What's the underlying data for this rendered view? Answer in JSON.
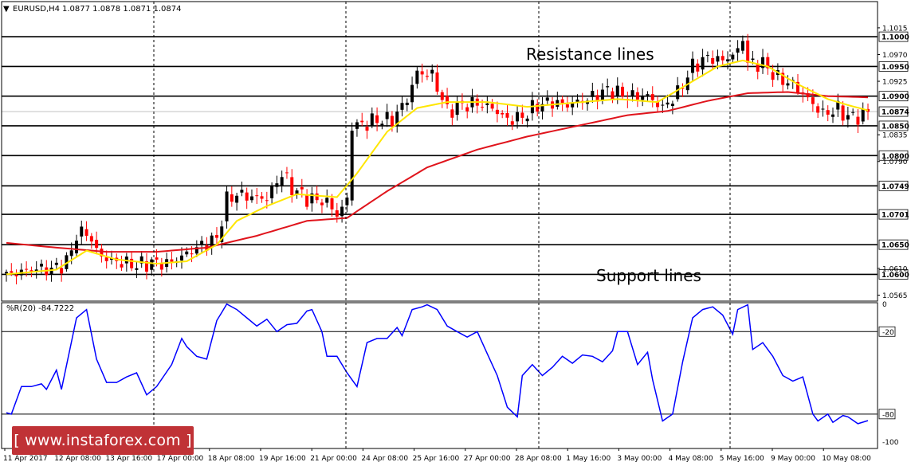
{
  "header": {
    "symbol_label": "EURUSD,H4",
    "ohlc_label": "1.0877 1.0878 1.0871 1.0874"
  },
  "annotations": {
    "resistance": "Resistance lines",
    "support": "Support lines"
  },
  "indicator": {
    "label": "%R(20) -84.7222",
    "levels": [
      "0",
      "-20",
      "-80",
      "-100"
    ]
  },
  "watermark": "[ www.instaforex.com ]",
  "colors": {
    "bull_body": "#000000",
    "bear_body": "#ff0000",
    "sma_fast": "#ffe600",
    "sma_slow": "#e0141c",
    "wpr_line": "#0000ff",
    "level_line": "#000000",
    "current_price_line": "#c0c0c0"
  },
  "chart_data": [
    {
      "type": "candlestick",
      "title": "EURUSD,H4",
      "ylim": [
        1.0555,
        1.1035
      ],
      "y_ticks": [
        "1.1015",
        "1.0970",
        "1.0925",
        "1.0835",
        "1.0790",
        "1.0610",
        "1.0565"
      ],
      "x_ticks": [
        "11 Apr 2017",
        "12 Apr 08:00",
        "13 Apr 16:00",
        "17 Apr 00:00",
        "18 Apr 08:00",
        "19 Apr 16:00",
        "21 Apr 00:00",
        "24 Apr 08:00",
        "25 Apr 16:00",
        "27 Apr 00:00",
        "28 Apr 08:00",
        "1 May 16:00",
        "3 May 00:00",
        "4 May 08:00",
        "5 May 16:00",
        "9 May 00:00",
        "10 May 08:00"
      ],
      "horizontal_levels": [
        {
          "label": "1.1000",
          "value": 1.1
        },
        {
          "label": "1.0950",
          "value": 1.095
        },
        {
          "label": "1.0900",
          "value": 1.09
        },
        {
          "label": "1.0850",
          "value": 1.085
        },
        {
          "label": "1.0800",
          "value": 1.08
        },
        {
          "label": "1.0749",
          "value": 1.0749
        },
        {
          "label": "1.0701",
          "value": 1.0701
        },
        {
          "label": "1.0650",
          "value": 1.065
        },
        {
          "label": "1.0600",
          "value": 1.06
        }
      ],
      "current_price": {
        "label": "1.0874",
        "value": 1.0874
      },
      "period_separators": [
        "12 Apr",
        "17 Apr",
        "24 Apr",
        "27 Apr",
        "3 May",
        "5 May"
      ],
      "anchors": [
        [
          0,
          1.0598
        ],
        [
          3,
          1.0605
        ],
        [
          6,
          1.061
        ],
        [
          9,
          1.0608
        ],
        [
          12,
          1.062
        ],
        [
          14,
          1.0665
        ],
        [
          16,
          1.0672
        ],
        [
          18,
          1.064
        ],
        [
          20,
          1.0625
        ],
        [
          23,
          1.062
        ],
        [
          26,
          1.0615
        ],
        [
          29,
          1.062
        ],
        [
          32,
          1.0618
        ],
        [
          35,
          1.063
        ],
        [
          38,
          1.0645
        ],
        [
          42,
          1.066
        ],
        [
          44,
          1.0725
        ],
        [
          46,
          1.0735
        ],
        [
          49,
          1.073
        ],
        [
          52,
          1.0728
        ],
        [
          55,
          1.077
        ],
        [
          57,
          1.0745
        ],
        [
          60,
          1.0728
        ],
        [
          64,
          1.0722
        ],
        [
          66,
          1.07
        ],
        [
          68,
          1.0725
        ],
        [
          69,
          1.085
        ],
        [
          71,
          1.0852
        ],
        [
          74,
          1.086
        ],
        [
          77,
          1.086
        ],
        [
          80,
          1.0895
        ],
        [
          82,
          1.094
        ],
        [
          85,
          1.0935
        ],
        [
          88,
          1.0875
        ],
        [
          91,
          1.0885
        ],
        [
          94,
          1.0888
        ],
        [
          97,
          1.088
        ],
        [
          100,
          1.086
        ],
        [
          103,
          1.0865
        ],
        [
          106,
          1.0885
        ],
        [
          109,
          1.089
        ],
        [
          112,
          1.0885
        ],
        [
          116,
          1.0895
        ],
        [
          120,
          1.091
        ],
        [
          124,
          1.09
        ],
        [
          128,
          1.09
        ],
        [
          131,
          1.088
        ],
        [
          134,
          1.0905
        ],
        [
          137,
          1.095
        ],
        [
          140,
          1.0965
        ],
        [
          143,
          1.096
        ],
        [
          146,
          1.0975
        ],
        [
          147,
          1.1
        ],
        [
          148,
          1.0955
        ],
        [
          151,
          1.0955
        ],
        [
          154,
          1.093
        ],
        [
          157,
          1.092
        ],
        [
          160,
          1.0895
        ],
        [
          163,
          1.087
        ],
        [
          166,
          1.0878
        ],
        [
          168,
          1.0865
        ],
        [
          170,
          1.0865
        ],
        [
          172,
          1.0874
        ]
      ],
      "sma_fast_points": [
        [
          0,
          1.06
        ],
        [
          10,
          1.0608
        ],
        [
          16,
          1.064
        ],
        [
          22,
          1.0625
        ],
        [
          30,
          1.0618
        ],
        [
          36,
          1.0622
        ],
        [
          42,
          1.065
        ],
        [
          46,
          1.069
        ],
        [
          52,
          1.0715
        ],
        [
          58,
          1.0735
        ],
        [
          66,
          1.073
        ],
        [
          70,
          1.077
        ],
        [
          76,
          1.084
        ],
        [
          82,
          1.088
        ],
        [
          88,
          1.089
        ],
        [
          96,
          1.089
        ],
        [
          104,
          1.0882
        ],
        [
          112,
          1.0888
        ],
        [
          122,
          1.0895
        ],
        [
          130,
          1.089
        ],
        [
          136,
          1.092
        ],
        [
          142,
          1.095
        ],
        [
          147,
          1.096
        ],
        [
          152,
          1.095
        ],
        [
          158,
          1.092
        ],
        [
          164,
          1.0895
        ],
        [
          168,
          1.0885
        ],
        [
          172,
          1.0876
        ]
      ],
      "sma_slow_points": [
        [
          0,
          1.0653
        ],
        [
          10,
          1.0645
        ],
        [
          20,
          1.0638
        ],
        [
          30,
          1.0638
        ],
        [
          40,
          1.0645
        ],
        [
          50,
          1.0665
        ],
        [
          60,
          1.069
        ],
        [
          68,
          1.0695
        ],
        [
          76,
          1.074
        ],
        [
          84,
          1.078
        ],
        [
          94,
          1.081
        ],
        [
          104,
          1.0832
        ],
        [
          114,
          1.085
        ],
        [
          124,
          1.0868
        ],
        [
          132,
          1.0875
        ],
        [
          140,
          1.0892
        ],
        [
          148,
          1.0905
        ],
        [
          156,
          1.0907
        ],
        [
          164,
          1.09
        ],
        [
          172,
          1.0898
        ]
      ]
    },
    {
      "type": "line",
      "title": "%R(20) -84.7222",
      "ylim": [
        -105,
        1
      ],
      "levels": [
        -20,
        -80
      ],
      "points": [
        [
          0,
          -79
        ],
        [
          1,
          -80
        ],
        [
          3,
          -60
        ],
        [
          5,
          -60
        ],
        [
          7,
          -58
        ],
        [
          8,
          -62
        ],
        [
          10,
          -48
        ],
        [
          11,
          -62
        ],
        [
          14,
          -10
        ],
        [
          16,
          -4
        ],
        [
          18,
          -40
        ],
        [
          20,
          -57
        ],
        [
          22,
          -57
        ],
        [
          24,
          -53
        ],
        [
          26,
          -50
        ],
        [
          28,
          -66
        ],
        [
          30,
          -60
        ],
        [
          33,
          -44
        ],
        [
          35,
          -25
        ],
        [
          36,
          -31
        ],
        [
          38,
          -38
        ],
        [
          40,
          -40
        ],
        [
          42,
          -12
        ],
        [
          43,
          -6
        ],
        [
          44,
          0
        ],
        [
          46,
          -4
        ],
        [
          48,
          -10
        ],
        [
          50,
          -16
        ],
        [
          52,
          -11
        ],
        [
          54,
          -20
        ],
        [
          56,
          -15
        ],
        [
          58,
          -14
        ],
        [
          60,
          -5
        ],
        [
          61,
          -4
        ],
        [
          63,
          -20
        ],
        [
          64,
          -38
        ],
        [
          66,
          -38
        ],
        [
          68,
          -50
        ],
        [
          70,
          -60
        ],
        [
          72,
          -28
        ],
        [
          74,
          -25
        ],
        [
          76,
          -25
        ],
        [
          78,
          -17
        ],
        [
          79,
          -23
        ],
        [
          81,
          -4
        ],
        [
          83,
          -2
        ],
        [
          84,
          -0.5
        ],
        [
          86,
          -4
        ],
        [
          88,
          -16
        ],
        [
          90,
          -20
        ],
        [
          92,
          -24
        ],
        [
          94,
          -20
        ],
        [
          96,
          -36
        ],
        [
          98,
          -52
        ],
        [
          100,
          -75
        ],
        [
          102,
          -82
        ],
        [
          103,
          -52
        ],
        [
          105,
          -44
        ],
        [
          107,
          -52
        ],
        [
          109,
          -46
        ],
        [
          111,
          -38
        ],
        [
          113,
          -43
        ],
        [
          115,
          -37
        ],
        [
          117,
          -38
        ],
        [
          119,
          -42
        ],
        [
          121,
          -34
        ],
        [
          122,
          -20
        ],
        [
          124,
          -20
        ],
        [
          126,
          -44
        ],
        [
          128,
          -35
        ],
        [
          129,
          -55
        ],
        [
          131,
          -85
        ],
        [
          133,
          -80
        ],
        [
          135,
          -42
        ],
        [
          137,
          -10
        ],
        [
          139,
          -4
        ],
        [
          141,
          -2
        ],
        [
          143,
          -8
        ],
        [
          145,
          -22
        ],
        [
          146,
          -4
        ],
        [
          148,
          -0.5
        ],
        [
          149,
          -33
        ],
        [
          151,
          -28
        ],
        [
          153,
          -38
        ],
        [
          155,
          -52
        ],
        [
          157,
          -56
        ],
        [
          159,
          -53
        ],
        [
          161,
          -80
        ],
        [
          162,
          -85
        ],
        [
          164,
          -80
        ],
        [
          165,
          -86
        ],
        [
          167,
          -81
        ],
        [
          168,
          -82
        ],
        [
          170,
          -87
        ],
        [
          172,
          -84.7
        ]
      ]
    }
  ]
}
